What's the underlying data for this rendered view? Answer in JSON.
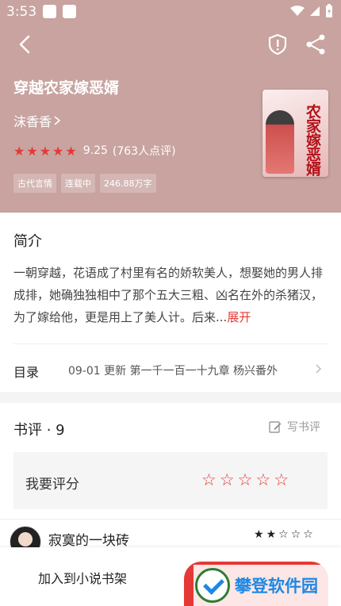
{
  "status_bar": {
    "time": "3:53"
  },
  "book": {
    "title": "穿越农家嫁恶婿",
    "author": "沫香香",
    "rating": "9.25",
    "rating_count": "(763人点评)",
    "stars": 4.5,
    "tags": [
      "古代言情",
      "连载中",
      "246.88万字"
    ],
    "cover_title": "农家嫁恶婿"
  },
  "intro": {
    "title": "简介",
    "text": "一朝穿越，花语成了村里有名的娇软美人，想娶她的男人排成排，她确独独相中了那个五大三粗、凶名在外的杀猪汉，为了嫁给他，更是用上了美人计。后来...",
    "more": "展开"
  },
  "toc": {
    "label": "目录",
    "info": "09-01  更新  第一千一百一十九章 杨兴番外"
  },
  "reviews": {
    "title": "书评 · 9",
    "write_label": "写书评",
    "rate_label": "我要评分",
    "first_reviewer": "寂寞的一块砖",
    "first_reviewer_stars": 2
  },
  "bottom": {
    "add_shelf": "加入到小说书架"
  },
  "watermark": {
    "text": "攀登软件园"
  },
  "colors": {
    "hero": "#c8a39f",
    "accent": "#e53935"
  }
}
